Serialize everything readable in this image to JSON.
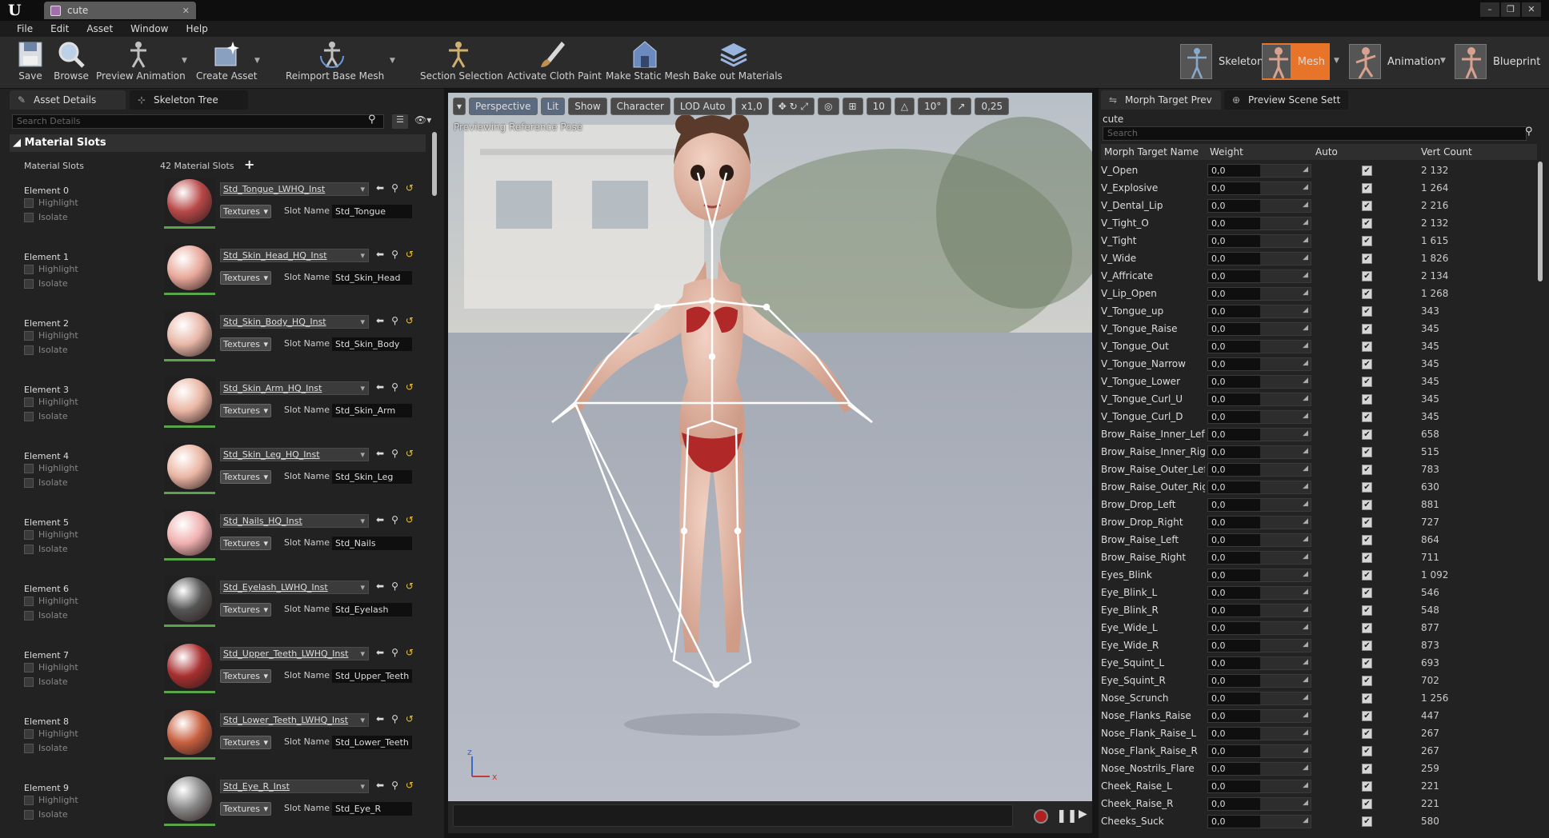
{
  "app": {
    "tab_title": "cute",
    "window_controls": [
      "–",
      "❐",
      "✕"
    ]
  },
  "menu": [
    "File",
    "Edit",
    "Asset",
    "Window",
    "Help"
  ],
  "toolbar": [
    {
      "label": "Save",
      "icon": "save-icon"
    },
    {
      "label": "Browse",
      "icon": "browse-icon"
    },
    {
      "label": "Preview Animation",
      "icon": "preview-animation-icon"
    },
    {
      "label": "Create Asset",
      "icon": "create-asset-icon"
    },
    {
      "label": "Reimport Base Mesh",
      "icon": "reimport-icon"
    },
    {
      "label": "Section Selection",
      "icon": "section-selection-icon"
    },
    {
      "label": "Activate Cloth Paint",
      "icon": "cloth-paint-icon"
    },
    {
      "label": "Make Static Mesh",
      "icon": "static-mesh-icon"
    },
    {
      "label": "Bake out Materials",
      "icon": "bake-materials-icon"
    }
  ],
  "modes": [
    {
      "label": "Skeleton",
      "active": false
    },
    {
      "label": "Mesh",
      "active": true
    },
    {
      "label": "Animation",
      "active": false
    },
    {
      "label": "Blueprint",
      "active": false
    }
  ],
  "left_panel": {
    "tabs": [
      "Asset Details",
      "Skeleton Tree"
    ],
    "search_placeholder": "Search Details",
    "section": "Material Slots",
    "slots_label": "Material Slots",
    "slots_count": "42 Material Slots",
    "highlight_label": "Highlight",
    "isolate_label": "Isolate",
    "textures_label": "Textures",
    "slot_name_label": "Slot Name",
    "elements": [
      {
        "label": "Element 0",
        "material": "Std_Tongue_LWHQ_Inst",
        "slot": "Std_Tongue",
        "color": "#b84848"
      },
      {
        "label": "Element 1",
        "material": "Std_Skin_Head_HQ_Inst",
        "slot": "Std_Skin_Head",
        "color": "#e8a89a"
      },
      {
        "label": "Element 2",
        "material": "Std_Skin_Body_HQ_Inst",
        "slot": "Std_Skin_Body",
        "color": "#e8b8a8"
      },
      {
        "label": "Element 3",
        "material": "Std_Skin_Arm_HQ_Inst",
        "slot": "Std_Skin_Arm",
        "color": "#eab6a4"
      },
      {
        "label": "Element 4",
        "material": "Std_Skin_Leg_HQ_Inst",
        "slot": "Std_Skin_Leg",
        "color": "#eab6a4"
      },
      {
        "label": "Element 5",
        "material": "Std_Nails_HQ_Inst",
        "slot": "Std_Nails",
        "color": "#f0b0b0"
      },
      {
        "label": "Element 6",
        "material": "Std_Eyelash_LWHQ_Inst",
        "slot": "Std_Eyelash",
        "color": "#555555"
      },
      {
        "label": "Element 7",
        "material": "Std_Upper_Teeth_LWHQ_Inst",
        "slot": "Std_Upper_Teeth",
        "color": "#a83030"
      },
      {
        "label": "Element 8",
        "material": "Std_Lower_Teeth_LWHQ_Inst",
        "slot": "Std_Lower_Teeth",
        "color": "#c86040"
      },
      {
        "label": "Element 9",
        "material": "Std_Eye_R_Inst",
        "slot": "Std_Eye_R",
        "color": "#888888"
      }
    ]
  },
  "viewport": {
    "buttons": [
      "Perspective",
      "Lit",
      "Show",
      "Character",
      "LOD Auto",
      "x1,0",
      "10",
      "10°",
      "0,25"
    ],
    "overlay": "Previewing Reference Pose"
  },
  "right_panel": {
    "tabs": [
      "Morph Target Prev",
      "Preview Scene Sett"
    ],
    "asset_name": "cute",
    "search_placeholder": "Search",
    "columns": [
      "Morph Target Name",
      "Weight",
      "Auto",
      "Vert Count"
    ],
    "rows": [
      {
        "name": "V_Open",
        "weight": "0,0",
        "verts": "2 132"
      },
      {
        "name": "V_Explosive",
        "weight": "0,0",
        "verts": "1 264"
      },
      {
        "name": "V_Dental_Lip",
        "weight": "0,0",
        "verts": "2 216"
      },
      {
        "name": "V_Tight_O",
        "weight": "0,0",
        "verts": "2 132"
      },
      {
        "name": "V_Tight",
        "weight": "0,0",
        "verts": "1 615"
      },
      {
        "name": "V_Wide",
        "weight": "0,0",
        "verts": "1 826"
      },
      {
        "name": "V_Affricate",
        "weight": "0,0",
        "verts": "2 134"
      },
      {
        "name": "V_Lip_Open",
        "weight": "0,0",
        "verts": "1 268"
      },
      {
        "name": "V_Tongue_up",
        "weight": "0,0",
        "verts": "343"
      },
      {
        "name": "V_Tongue_Raise",
        "weight": "0,0",
        "verts": "345"
      },
      {
        "name": "V_Tongue_Out",
        "weight": "0,0",
        "verts": "345"
      },
      {
        "name": "V_Tongue_Narrow",
        "weight": "0,0",
        "verts": "345"
      },
      {
        "name": "V_Tongue_Lower",
        "weight": "0,0",
        "verts": "345"
      },
      {
        "name": "V_Tongue_Curl_U",
        "weight": "0,0",
        "verts": "345"
      },
      {
        "name": "V_Tongue_Curl_D",
        "weight": "0,0",
        "verts": "345"
      },
      {
        "name": "Brow_Raise_Inner_Left",
        "weight": "0,0",
        "verts": "658"
      },
      {
        "name": "Brow_Raise_Inner_Right",
        "weight": "0,0",
        "verts": "515"
      },
      {
        "name": "Brow_Raise_Outer_Left",
        "weight": "0,0",
        "verts": "783"
      },
      {
        "name": "Brow_Raise_Outer_Right",
        "weight": "0,0",
        "verts": "630"
      },
      {
        "name": "Brow_Drop_Left",
        "weight": "0,0",
        "verts": "881"
      },
      {
        "name": "Brow_Drop_Right",
        "weight": "0,0",
        "verts": "727"
      },
      {
        "name": "Brow_Raise_Left",
        "weight": "0,0",
        "verts": "864"
      },
      {
        "name": "Brow_Raise_Right",
        "weight": "0,0",
        "verts": "711"
      },
      {
        "name": "Eyes_Blink",
        "weight": "0,0",
        "verts": "1 092"
      },
      {
        "name": "Eye_Blink_L",
        "weight": "0,0",
        "verts": "546"
      },
      {
        "name": "Eye_Blink_R",
        "weight": "0,0",
        "verts": "548"
      },
      {
        "name": "Eye_Wide_L",
        "weight": "0,0",
        "verts": "877"
      },
      {
        "name": "Eye_Wide_R",
        "weight": "0,0",
        "verts": "873"
      },
      {
        "name": "Eye_Squint_L",
        "weight": "0,0",
        "verts": "693"
      },
      {
        "name": "Eye_Squint_R",
        "weight": "0,0",
        "verts": "702"
      },
      {
        "name": "Nose_Scrunch",
        "weight": "0,0",
        "verts": "1 256"
      },
      {
        "name": "Nose_Flanks_Raise",
        "weight": "0,0",
        "verts": "447"
      },
      {
        "name": "Nose_Flank_Raise_L",
        "weight": "0,0",
        "verts": "267"
      },
      {
        "name": "Nose_Flank_Raise_R",
        "weight": "0,0",
        "verts": "267"
      },
      {
        "name": "Nose_Nostrils_Flare",
        "weight": "0,0",
        "verts": "259"
      },
      {
        "name": "Cheek_Raise_L",
        "weight": "0,0",
        "verts": "221"
      },
      {
        "name": "Cheek_Raise_R",
        "weight": "0,0",
        "verts": "221"
      },
      {
        "name": "Cheeks_Suck",
        "weight": "0,0",
        "verts": "580"
      }
    ]
  },
  "colors": {
    "accent": "#e8742a",
    "panel": "#222222",
    "checkbox": "#d6d6d6"
  }
}
